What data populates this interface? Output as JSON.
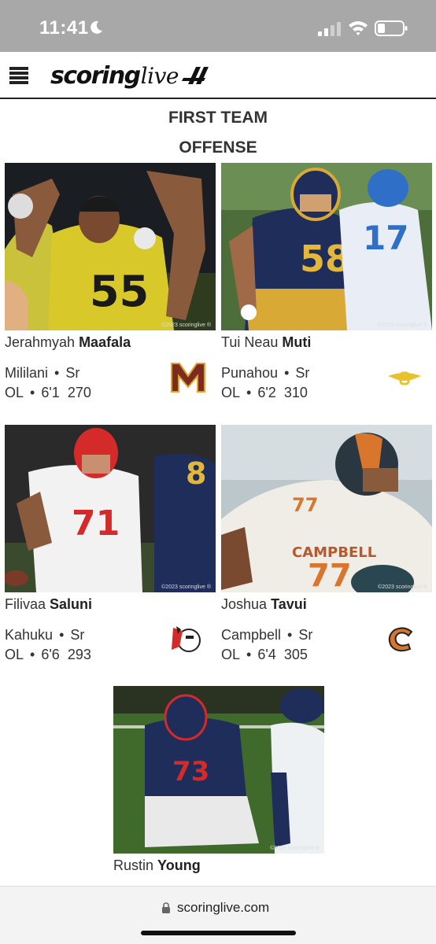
{
  "status_bar": {
    "time": "11:41"
  },
  "header": {
    "logo_text": "scoring",
    "logo_script": "live"
  },
  "headings": {
    "title": "FIRST TEAM",
    "subtitle": "OFFENSE"
  },
  "watermark": "©2023 scoringlive ®",
  "players": [
    {
      "first": "Jerahmyah",
      "last": "Maafala",
      "school": "Mililani",
      "year": "Sr",
      "position": "OL",
      "height": "6'1",
      "weight": "270",
      "jersey": "55",
      "logo": "mililani-m-logo"
    },
    {
      "first": "Tui Neau",
      "last": "Muti",
      "school": "Punahou",
      "year": "Sr",
      "position": "OL",
      "height": "6'2",
      "weight": "310",
      "jersey": "58",
      "logo": "punahou-logo"
    },
    {
      "first": "Filivaa",
      "last": "Saluni",
      "school": "Kahuku",
      "year": "Sr",
      "position": "OL",
      "height": "6'6",
      "weight": "293",
      "jersey": "71",
      "logo": "kahuku-red-raider-logo"
    },
    {
      "first": "Joshua",
      "last": "Tavui",
      "school": "Campbell",
      "year": "Sr",
      "position": "OL",
      "height": "6'4",
      "weight": "305",
      "jersey": "77",
      "logo": "campbell-c-logo"
    },
    {
      "first": "Rustin",
      "last": "Young",
      "jersey": "73"
    }
  ],
  "browser": {
    "url": "scoringlive.com"
  },
  "colors": {
    "status_bar": "#a8a8a8",
    "mililani_gold": "#d9b400",
    "punahou_navy": "#1f2d5a",
    "kahuku_red": "#d42a2a",
    "campbell_orange": "#d8762e"
  }
}
